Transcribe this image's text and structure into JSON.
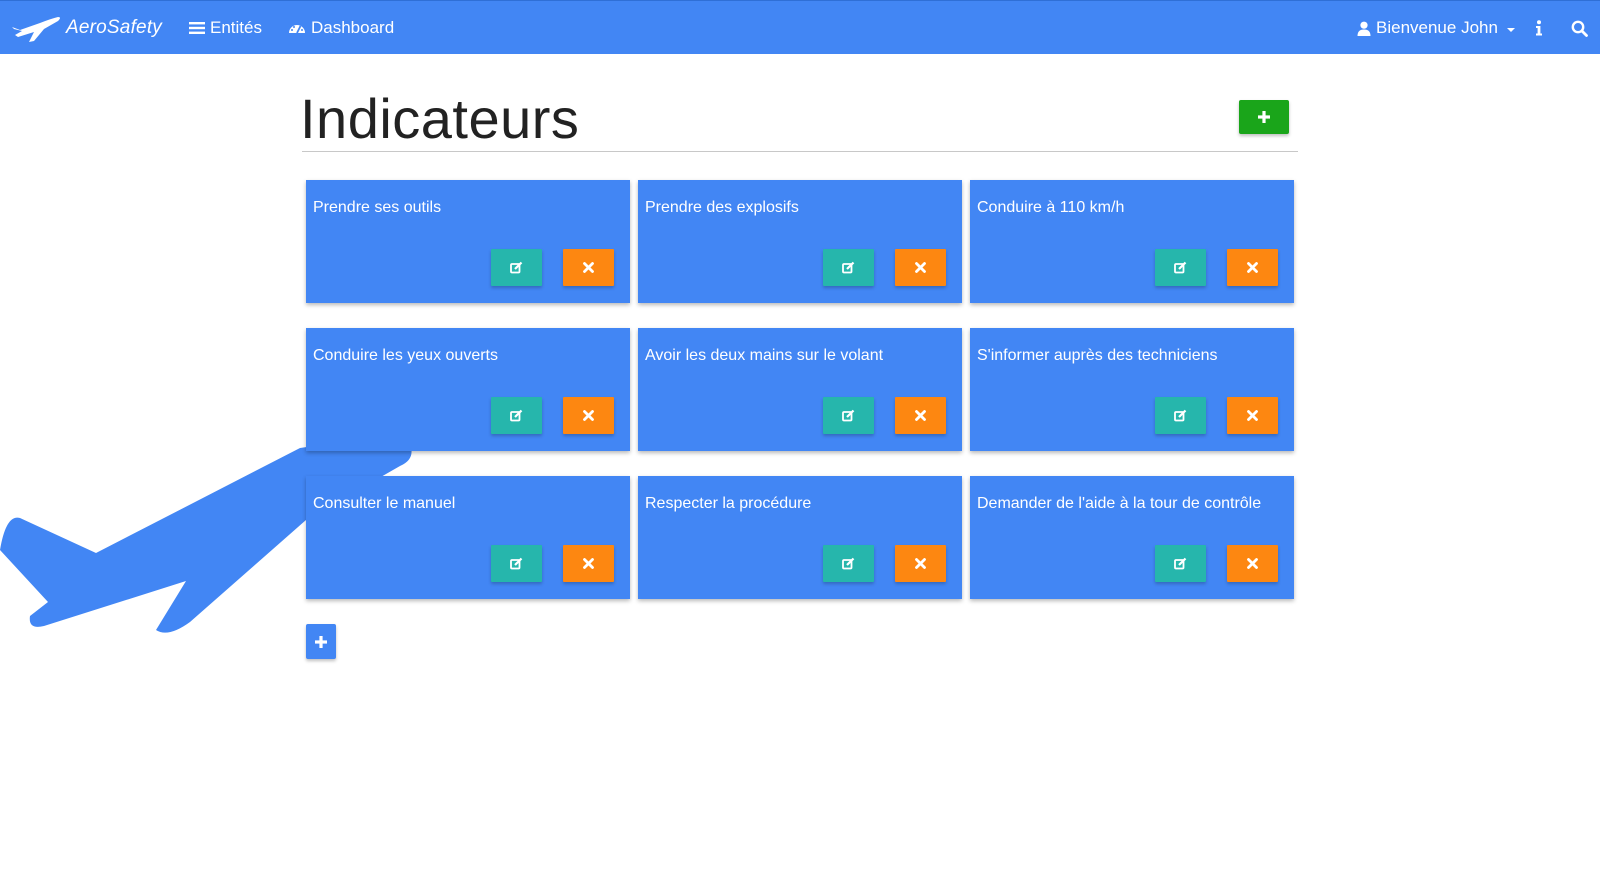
{
  "app": {
    "brand": "AeroSafety",
    "brand_icon": "airplane-logo-icon",
    "accent_color": "#4286f4"
  },
  "nav": {
    "entities_label": "Entités",
    "entities_icon": "bars-icon",
    "dashboard_label": "Dashboard",
    "dashboard_icon": "tachometer-icon",
    "user_label": "Bienvenue John",
    "user_icon": "user-icon",
    "info_icon": "info-icon",
    "search_icon": "search-icon"
  },
  "page": {
    "title": "Indicateurs"
  },
  "buttons": {
    "add_top_icon": "plus-icon",
    "add_bottom_icon": "plus-icon",
    "edit_icon": "edit-icon",
    "delete_icon": "close-icon",
    "add_color": "#1aa51a",
    "edit_color": "#26b6ac",
    "delete_color": "#fd8711"
  },
  "indicators": [
    {
      "title": "Prendre ses outils"
    },
    {
      "title": "Prendre des explosifs"
    },
    {
      "title": "Conduire à 110 km/h"
    },
    {
      "title": "Conduire les yeux ouverts"
    },
    {
      "title": "Avoir les deux mains sur le volant"
    },
    {
      "title": "S'informer auprès des techniciens"
    },
    {
      "title": "Consulter le manuel"
    },
    {
      "title": "Respecter la procédure"
    },
    {
      "title": "Demander de l'aide à la tour de contrôle"
    }
  ]
}
